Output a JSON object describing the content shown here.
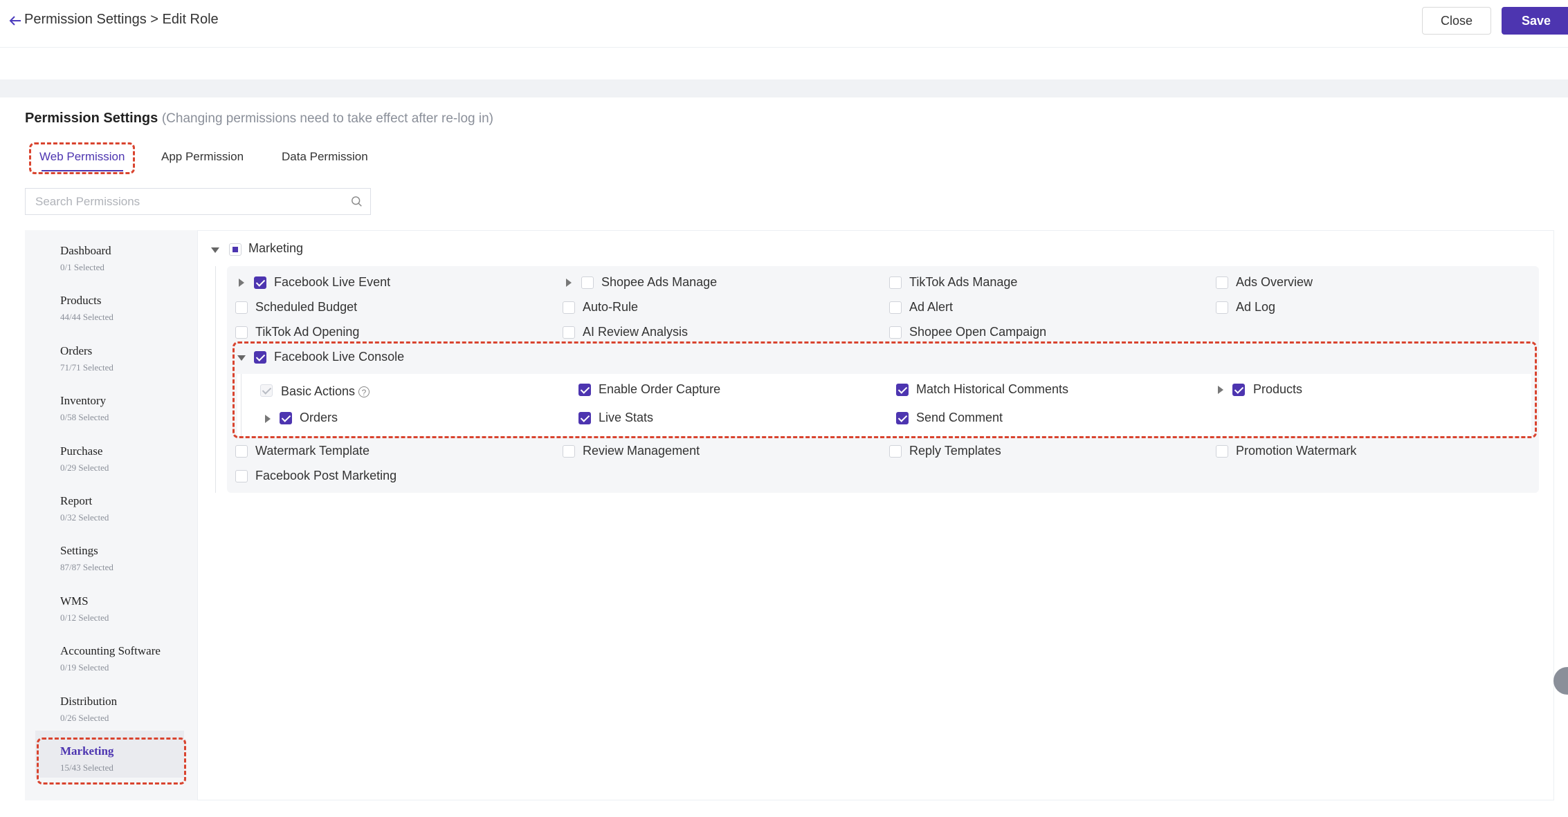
{
  "header": {
    "breadcrumb": "Permission Settings > Edit Role",
    "close_label": "Close",
    "save_label": "Save"
  },
  "section": {
    "title": "Permission Settings",
    "hint": "(Changing permissions need to take effect after re-log in)"
  },
  "tabs": [
    {
      "label": "Web Permission",
      "active": true
    },
    {
      "label": "App Permission",
      "active": false
    },
    {
      "label": "Data Permission",
      "active": false
    }
  ],
  "search": {
    "placeholder": "Search Permissions"
  },
  "sidebar": [
    {
      "name": "Dashboard",
      "count": "0/1 Selected"
    },
    {
      "name": "Products",
      "count": "44/44 Selected"
    },
    {
      "name": "Orders",
      "count": "71/71 Selected"
    },
    {
      "name": "Inventory",
      "count": "0/58 Selected"
    },
    {
      "name": "Purchase",
      "count": "0/29 Selected"
    },
    {
      "name": "Report",
      "count": "0/32 Selected"
    },
    {
      "name": "Settings",
      "count": "87/87 Selected"
    },
    {
      "name": "WMS",
      "count": "0/12 Selected"
    },
    {
      "name": "Accounting Software",
      "count": "0/19 Selected"
    },
    {
      "name": "Distribution",
      "count": "0/26 Selected"
    },
    {
      "name": "Marketing",
      "count": "15/43 Selected",
      "active": true
    }
  ],
  "tree": {
    "root": "Marketing",
    "items": [
      {
        "label": "Facebook Live Event",
        "checked": true
      },
      {
        "label": "Shopee Ads Manage",
        "checked": false
      },
      {
        "label": "TikTok Ads Manage",
        "checked": false
      },
      {
        "label": "Ads Overview",
        "checked": false
      },
      {
        "label": "Scheduled Budget",
        "checked": false
      },
      {
        "label": "Auto-Rule",
        "checked": false
      },
      {
        "label": "Ad Alert",
        "checked": false
      },
      {
        "label": "Ad Log",
        "checked": false
      },
      {
        "label": "TikTok Ad Opening",
        "checked": false
      },
      {
        "label": "AI Review Analysis",
        "checked": false
      },
      {
        "label": "Shopee Open Campaign",
        "checked": false
      }
    ],
    "console": {
      "label": "Facebook Live Console",
      "children": [
        {
          "label": "Basic Actions"
        },
        {
          "label": "Enable Order Capture"
        },
        {
          "label": "Match Historical Comments"
        },
        {
          "label": "Products"
        },
        {
          "label": "Orders"
        },
        {
          "label": "Live Stats"
        },
        {
          "label": "Send Comment"
        }
      ]
    },
    "more_items": [
      {
        "label": "Watermark Template"
      },
      {
        "label": "Review Management"
      },
      {
        "label": "Reply Templates"
      },
      {
        "label": "Promotion Watermark"
      },
      {
        "label": "Facebook Post Marketing"
      }
    ]
  },
  "colors": {
    "accent": "#4d35b0",
    "highlight": "#d9442f"
  }
}
